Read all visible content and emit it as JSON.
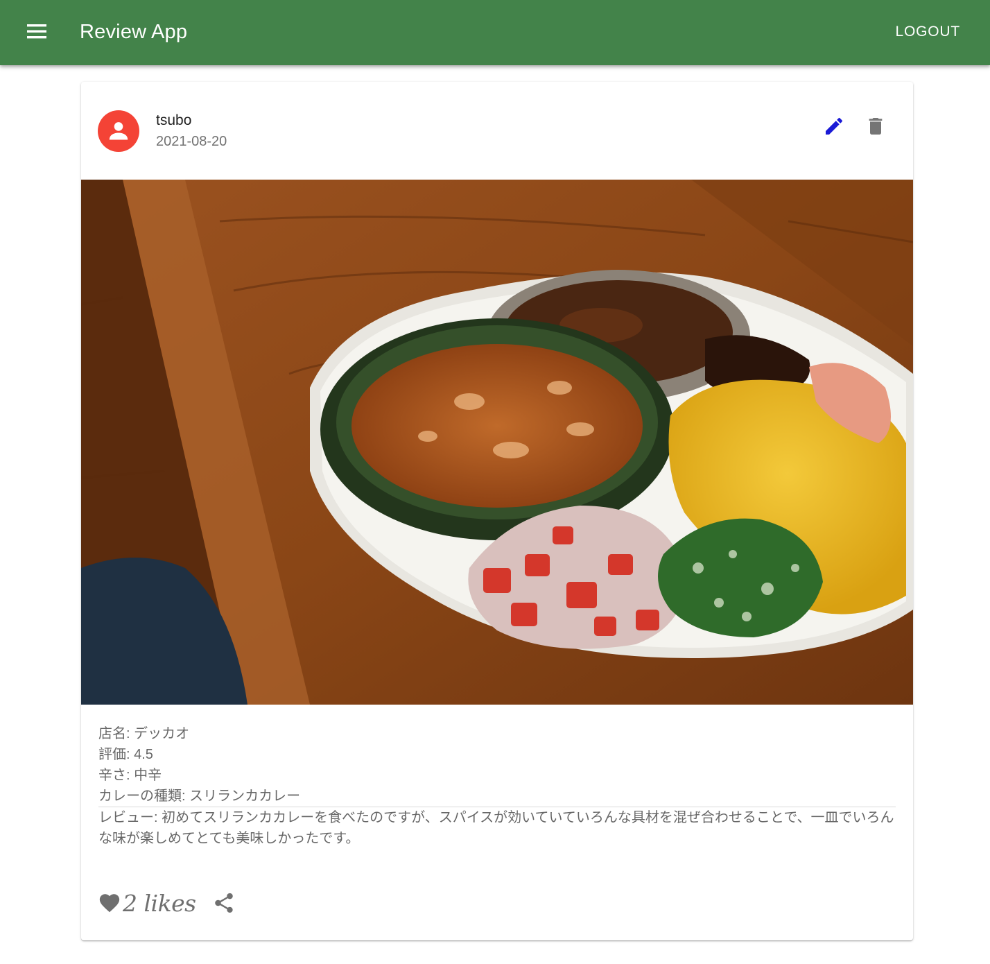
{
  "app_bar": {
    "title": "Review App",
    "logout_label": "LOGOUT",
    "color": "#43834a",
    "menu_icon": "menu-icon"
  },
  "review": {
    "user": {
      "name": "tsubo",
      "date": "2021-08-20",
      "avatar_color": "#f44336",
      "avatar_icon": "account-circle-icon"
    },
    "actions": {
      "edit_icon": "pencil-icon",
      "delete_icon": "trash-icon",
      "edit_color": "#1a1ad6"
    },
    "details": {
      "shop": "店名: デッカオ",
      "rating": "評価: 4.5",
      "spiciness": "辛さ: 中辛",
      "curry_type": "カレーの種類: スリランカカレー",
      "review_text": "レビュー: 初めてスリランカカレーを食べたのですが、スパイスが効いていていろんな具材を混ぜ合わせることで、一皿でいろんな味が楽しめてとても美味しかったです。"
    },
    "footer": {
      "likes_text": "2 likes",
      "like_icon": "heart-icon",
      "share_icon": "share-icon"
    }
  }
}
